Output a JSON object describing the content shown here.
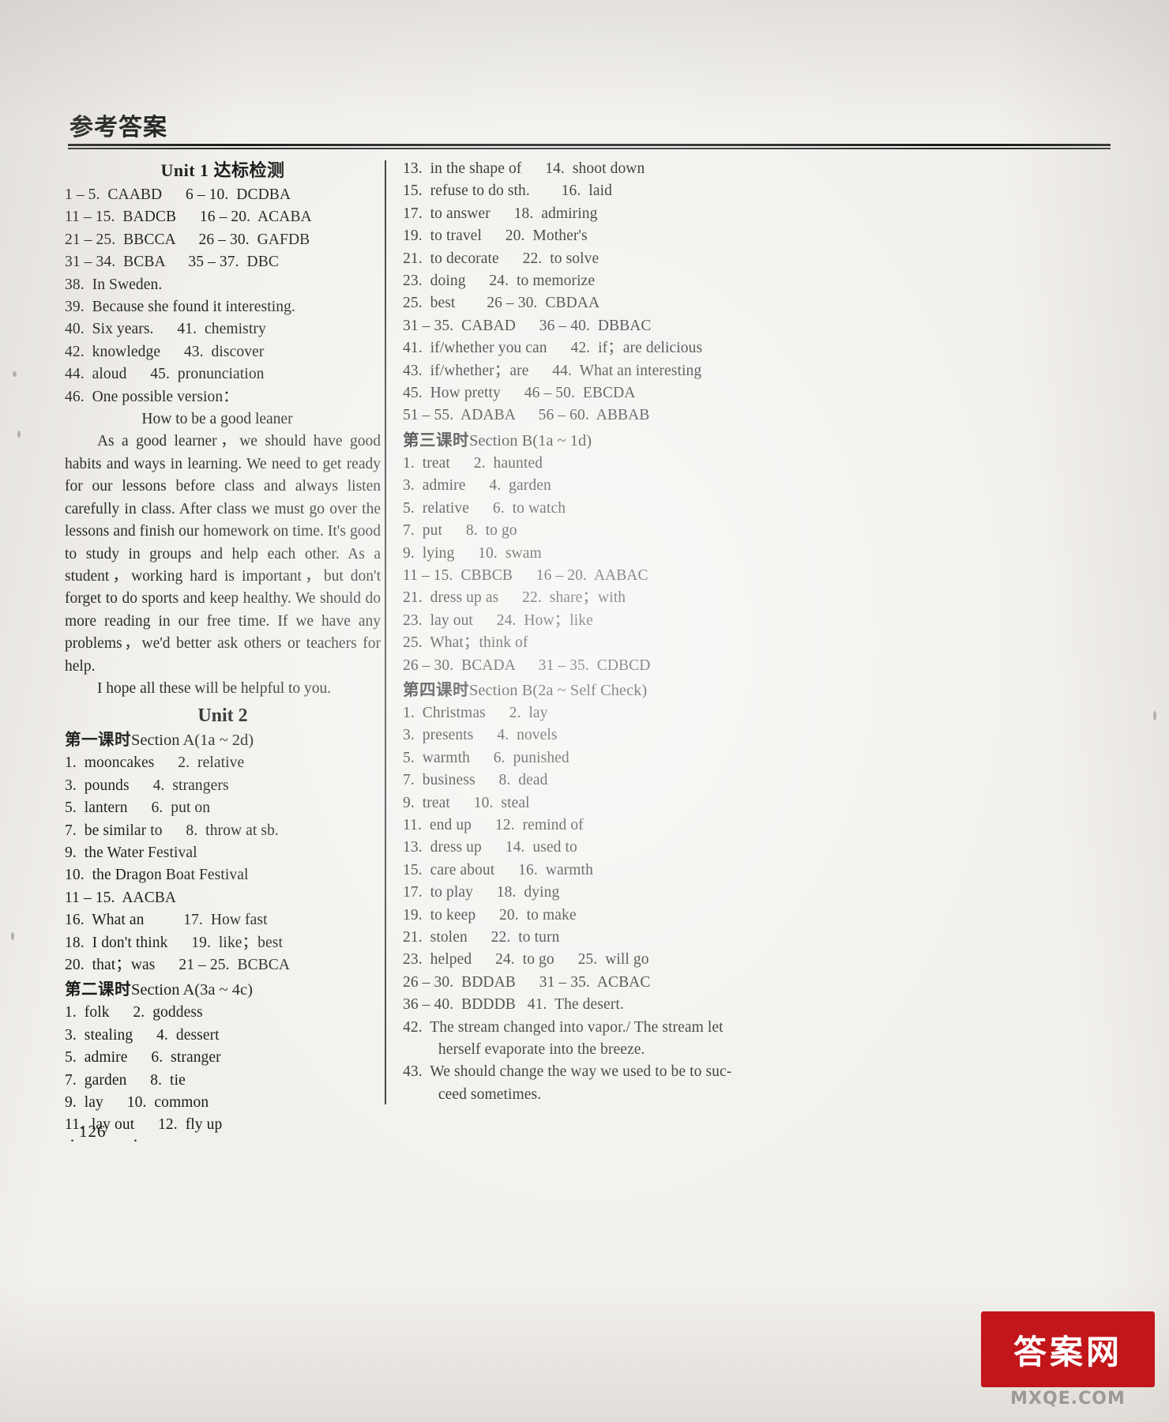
{
  "header": {
    "title": "参考答案"
  },
  "folio": {
    "page_number": "126",
    "dot_left": "·",
    "dot_right": "·"
  },
  "watermark": {
    "badge_text": "答案网",
    "url": "MXQE.COM"
  },
  "left_column": {
    "unit1_heading_en": "Unit 1",
    "unit1_heading_cn": "达标检测",
    "unit1_answers": [
      "1 – 5.  CAABD      6 – 10.  DCDBA",
      "11 – 15.  BADCB      16 – 20.  ACABA",
      "21 – 25.  BBCCA      26 – 30.  GAFDB",
      "31 – 34.  BCBA      35 – 37.  DBC",
      "38.  In Sweden.",
      "39.  Because she found it interesting.",
      "40.  Six years.      41.  chemistry",
      "42.  knowledge      43.  discover",
      "44.  aloud      45.  pronunciation",
      "46.  One possible version："
    ],
    "essay_title": "How to be a good leaner",
    "essay_paragraph": "As a good learner，we should have good habits and ways in learning. We need to get ready for our lessons before class and always listen carefully in class. After class we must go over the lessons and finish our homework on time. It's good to study in groups and help each other. As a student，working hard is important，but don't forget to do sports and keep healthy. We should do more reading in our free time. If we have any problems，we'd better ask others or teachers for help.",
    "essay_closing": "I hope all these will be helpful to you.",
    "unit2_heading": "Unit 2",
    "lesson1_cn": "第一课时",
    "lesson1_en": "Section A(1a ~ 2d)",
    "lesson1_answers": [
      "1.  mooncakes      2.  relative",
      "3.  pounds      4.  strangers",
      "5.  lantern      6.  put on",
      "7.  be similar to      8.  throw at sb.",
      "9.  the Water Festival",
      "10.  the Dragon Boat Festival",
      "11 – 15.  AACBA",
      "16.  What an          17.  How fast",
      "18.  I don't think      19.  like；best",
      "20.  that；was      21 – 25.  BCBCA"
    ],
    "lesson2_cn": "第二课时",
    "lesson2_en": "Section A(3a ~ 4c)",
    "lesson2_answers": [
      "1.  folk      2.  goddess",
      "3.  stealing      4.  dessert",
      "5.  admire      6.  stranger",
      "7.  garden      8.  tie",
      "9.  lay      10.  common",
      "11.  lay out      12.  fly up"
    ]
  },
  "right_column": {
    "continued_answers": [
      "13.  in the shape of      14.  shoot down",
      "15.  refuse to do sth.        16.  laid",
      "17.  to answer      18.  admiring",
      "19.  to travel      20.  Mother's",
      "21.  to decorate      22.  to solve",
      "23.  doing      24.  to memorize",
      "25.  best        26 – 30.  CBDAA",
      "31 – 35.  CABAD      36 – 40.  DBBAC",
      "41.  if/whether you can      42.  if；are delicious",
      "43.  if/whether；are      44.  What an interesting",
      "45.  How pretty      46 – 50.  EBCDA",
      "51 – 55.  ADABA      56 – 60.  ABBAB"
    ],
    "lesson3_cn": "第三课时",
    "lesson3_en": "Section B(1a ~ 1d)",
    "lesson3_answers": [
      "1.  treat      2.  haunted",
      "3.  admire      4.  garden",
      "5.  relative      6.  to watch",
      "7.  put      8.  to go",
      "9.  lying      10.  swam",
      "11 – 15.  CBBCB      16 – 20.  AABAC",
      "21.  dress up as      22.  share；with",
      "23.  lay out      24.  How；like",
      "25.  What；think of",
      "26 – 30.  BCADA      31 – 35.  CDBCD"
    ],
    "lesson4_cn": "第四课时",
    "lesson4_en": "Section B(2a ~ Self Check)",
    "lesson4_answers": [
      "1.  Christmas      2.  lay",
      "3.  presents      4.  novels",
      "5.  warmth      6.  punished",
      "7.  business      8.  dead",
      "9.  treat      10.  steal",
      "11.  end up      12.  remind of",
      "13.  dress up      14.  used to",
      "15.  care about      16.  warmth",
      "17.  to play      18.  dying",
      "19.  to keep      20.  to make",
      "21.  stolen      22.  to turn",
      "23.  helped      24.  to go      25.  will go",
      "26 – 30.  BDDAB      31 – 35.  ACBAC",
      "36 – 40.  BDDDB   41.  The desert."
    ],
    "long_answer_42_line1": "42.  The stream changed into vapor./ The stream let",
    "long_answer_42_line2": "herself evaporate into the breeze.",
    "long_answer_43_line1": "43.  We should change the way we used to be to suc-",
    "long_answer_43_line2": "ceed sometimes."
  }
}
